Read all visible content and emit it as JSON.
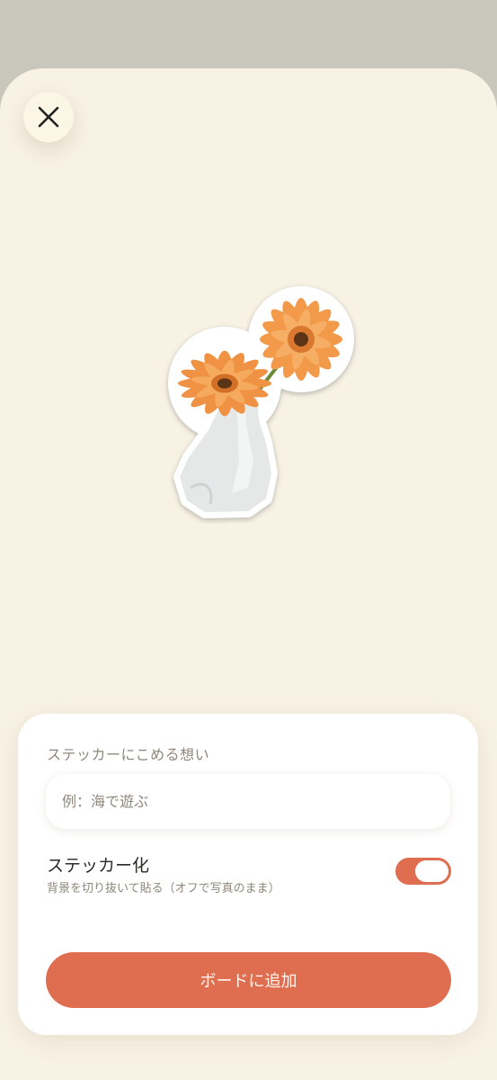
{
  "close_icon": "close-icon",
  "sticker": {
    "subject": "orange gerbera flowers in white vase",
    "colors": {
      "petal": "#f29a4a",
      "petal_dark": "#d9782e",
      "vase": "#e9eaea",
      "stem": "#6a8a3a"
    }
  },
  "card": {
    "title": "ステッカーにこめる想い",
    "input": {
      "placeholder": "例：海で遊ぶ",
      "value": ""
    },
    "toggle": {
      "label": "ステッカー化",
      "description": "背景を切り抜いて貼る（オフで写真のまま）",
      "on": true
    },
    "add_button": "ボードに追加"
  },
  "colors": {
    "accent": "#df6e50",
    "background": "#f8f2e5",
    "card": "#ffffff"
  }
}
